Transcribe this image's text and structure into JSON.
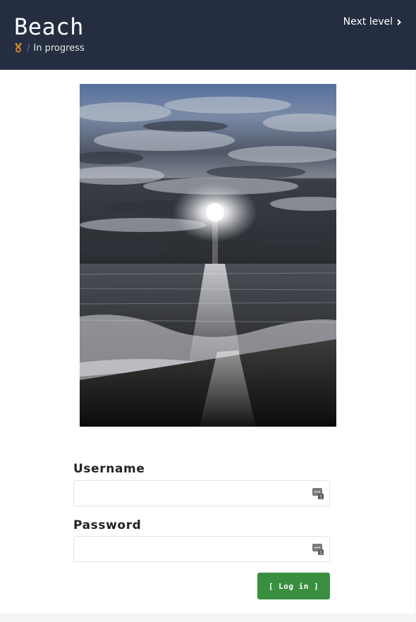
{
  "header": {
    "title": "Beach",
    "status_icon": "medal-icon",
    "status_separator": "/",
    "status_text": "In progress",
    "next_level_label": "Next level",
    "next_level_icon": "chevron-right-icon"
  },
  "main": {
    "image": {
      "subject": "beach-sunset-photo"
    },
    "form": {
      "username_label": "Username",
      "username_value": "",
      "username_icon": "password-manager-icon",
      "password_label": "Password",
      "password_value": "",
      "password_icon": "password-manager-icon",
      "login_button_label": "[ Log in ]"
    }
  },
  "colors": {
    "header_bg": "#242e40",
    "page_bg": "#ffffff",
    "outer_bg": "#f3f4f6",
    "button_bg": "#3a8e3f",
    "medal": "#c8832a",
    "icon_gray": "#707070"
  }
}
